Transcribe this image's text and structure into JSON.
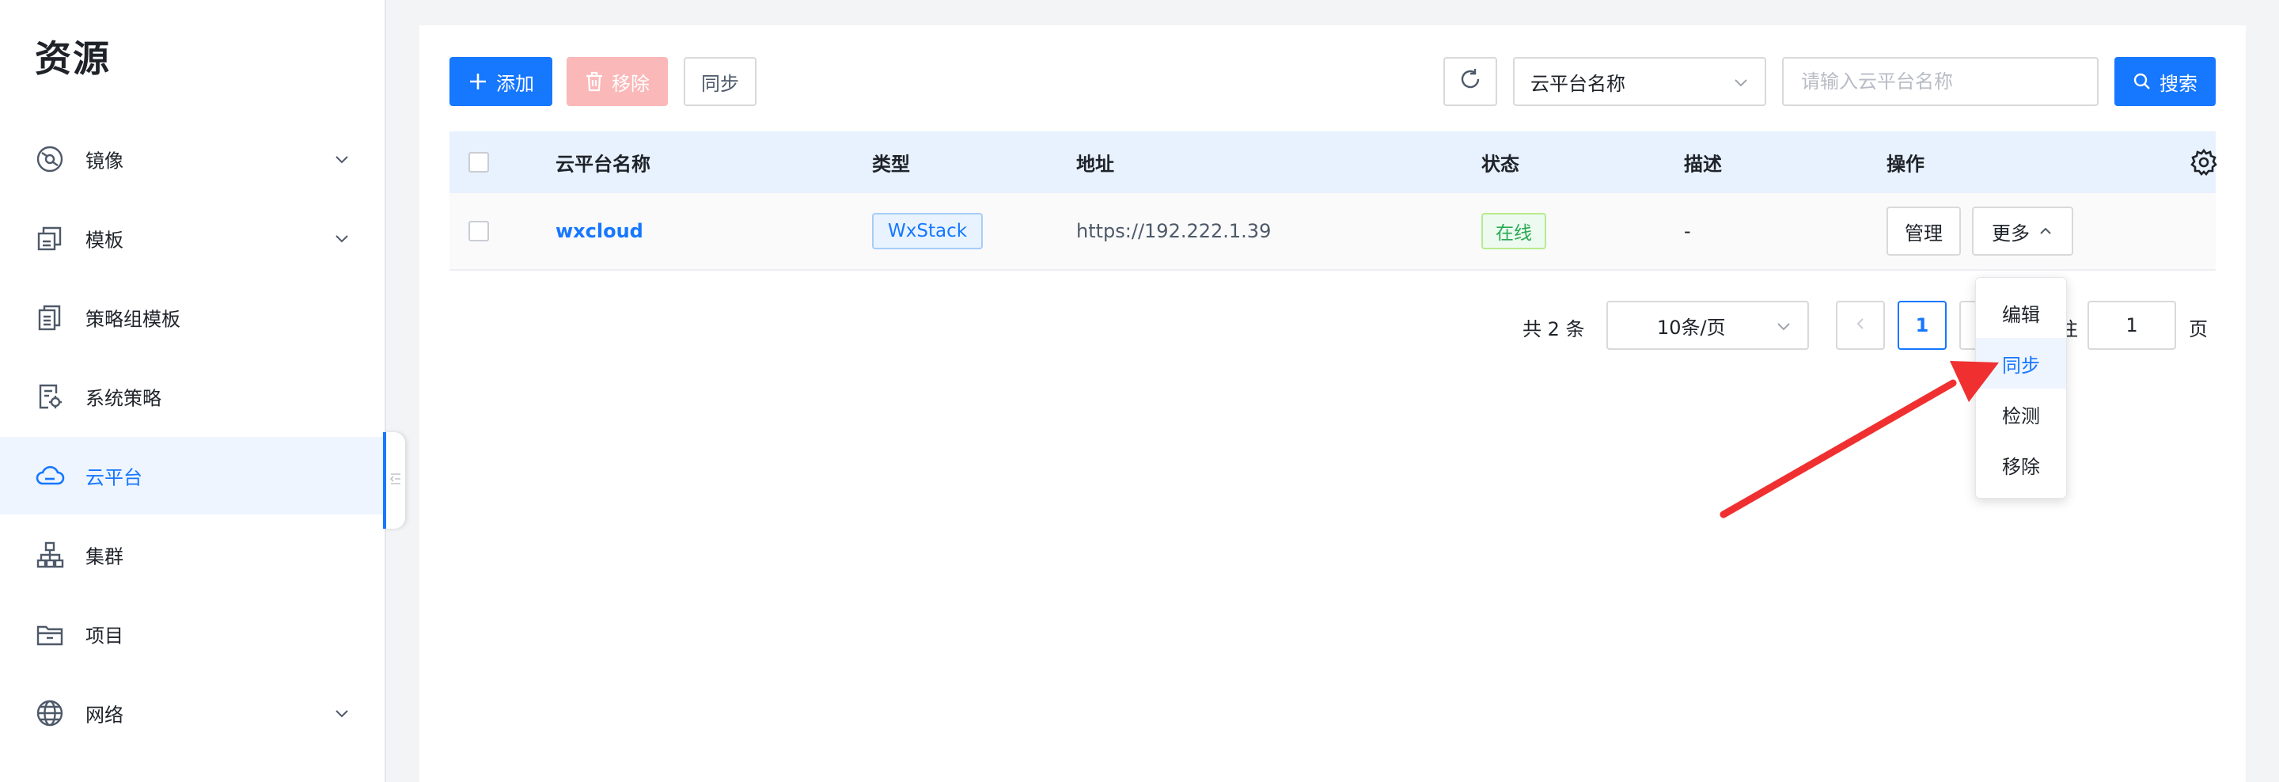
{
  "sidebar": {
    "title": "资源",
    "items": [
      {
        "label": "镜像",
        "icon": "disc-icon",
        "expandable": true
      },
      {
        "label": "模板",
        "icon": "template-icon",
        "expandable": true
      },
      {
        "label": "策略组模板",
        "icon": "document-stack-icon",
        "expandable": false
      },
      {
        "label": "系统策略",
        "icon": "policy-gear-icon",
        "expandable": false
      },
      {
        "label": "云平台",
        "icon": "cloud-icon",
        "expandable": false,
        "active": true
      },
      {
        "label": "集群",
        "icon": "cluster-icon",
        "expandable": false
      },
      {
        "label": "项目",
        "icon": "folder-icon",
        "expandable": false
      },
      {
        "label": "网络",
        "icon": "globe-icon",
        "expandable": true
      }
    ]
  },
  "toolbar": {
    "add_label": "添加",
    "remove_label": "移除",
    "sync_label": "同步",
    "filter_select_value": "云平台名称",
    "search_placeholder": "请输入云平台名称",
    "search_label": "搜索"
  },
  "table": {
    "headers": [
      "云平台名称",
      "类型",
      "地址",
      "状态",
      "描述",
      "操作"
    ],
    "rows": [
      {
        "name": "wxcloud",
        "type": "WxStack",
        "address": "https://192.222.1.39",
        "status": "在线",
        "description": "-",
        "manage_label": "管理",
        "more_label": "更多"
      }
    ]
  },
  "pagination": {
    "total_text": "共 2 条",
    "page_size": "10条/页",
    "current_page": "1",
    "goto_prefix": "前往",
    "goto_value": "1",
    "goto_suffix": "页"
  },
  "dropdown": {
    "items": [
      "编辑",
      "同步",
      "检测",
      "移除"
    ],
    "highlighted": "同步"
  },
  "colors": {
    "primary": "#1677ff",
    "danger_disabled": "#fbb8b8",
    "success": "#2aa952",
    "annotation_arrow": "#f03030"
  }
}
